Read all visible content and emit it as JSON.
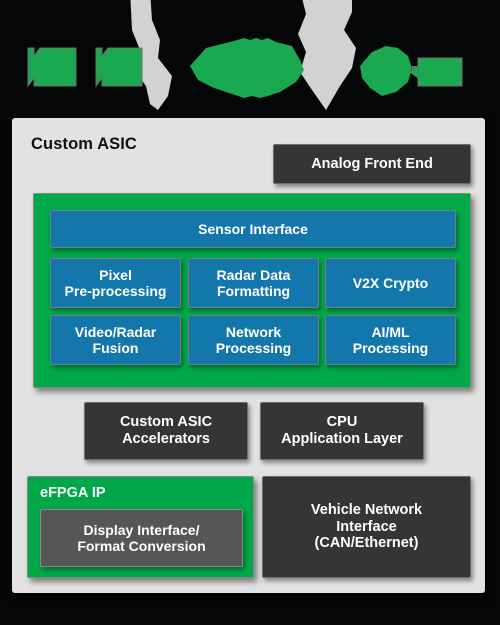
{
  "palette": {
    "background": "#050607",
    "panel_bg": "#e2e2e2",
    "green": "#00a849",
    "blue": "#1477ac",
    "dark_gray": "#353535",
    "medium_gray": "#575656",
    "light_gray_shape": "#d2d2d2",
    "text_light": "#ffffff",
    "text_dark": "#111111"
  },
  "top_graphic": {
    "name": "clipped-decorative-banner",
    "description": "partially cropped green and light-gray abstract block shapes on black"
  },
  "asic_panel": {
    "title": "Custom ASIC",
    "analog_front_end": "Analog Front End",
    "sensor_block": {
      "header_box": "Sensor Interface",
      "grid": [
        "Pixel\nPre-processing",
        "Radar Data\nFormatting",
        "V2X Crypto",
        "Video/Radar\nFusion",
        "Network\nProcessing",
        "AI/ML\nProcessing"
      ],
      "grid_lines": [
        [
          "Pixel",
          "Pre-processing"
        ],
        [
          "Radar Data",
          "Formatting"
        ],
        [
          "V2X Crypto"
        ],
        [
          "Video/Radar",
          "Fusion"
        ],
        [
          "Network",
          "Processing"
        ],
        [
          "AI/ML",
          "Processing"
        ]
      ]
    },
    "mid_row": {
      "accelerators_lines": [
        "Custom ASIC",
        "Accelerators"
      ],
      "cpu_lines": [
        "CPU",
        "Application Layer"
      ]
    },
    "bottom_row": {
      "efpga_label": "eFPGA IP",
      "display_interface_lines": [
        "Display Interface/",
        "Format Conversion"
      ],
      "vehicle_network_lines": [
        "Vehicle Network",
        "Interface",
        "(CAN/Ethernet)"
      ]
    }
  }
}
